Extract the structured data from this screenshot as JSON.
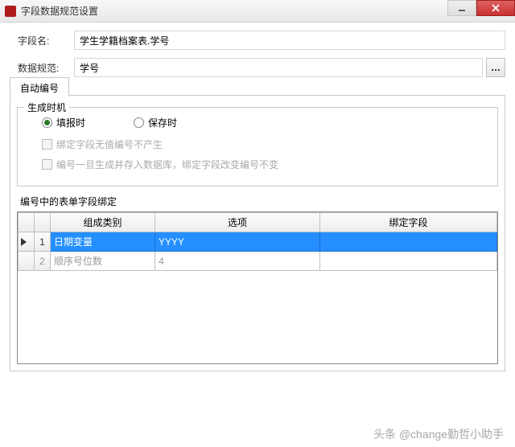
{
  "window": {
    "title": "字段数据规范设置"
  },
  "form": {
    "label_field_name": "字段名:",
    "value_field_name": "学生学籍档案表.学号",
    "label_data_spec": "数据规范:",
    "value_data_spec": "学号",
    "browse_label": "…"
  },
  "tab": {
    "auto_number": "自动编号"
  },
  "timing": {
    "legend": "生成时机",
    "radio_fill": "填报时",
    "radio_save": "保存时",
    "check_nobind": "绑定字段无值编号不产生",
    "check_storefix": "编号一旦生成并存入数据库，绑定字段改变编号不变"
  },
  "binding": {
    "section_label": "编号中的表单字段绑定",
    "col_type": "组成类别",
    "col_option": "选项",
    "col_bind": "绑定字段",
    "rows": [
      {
        "n": "1",
        "type": "日期变量",
        "option": "YYYY",
        "bind": ""
      },
      {
        "n": "2",
        "type": "顺序号位数",
        "option": "4",
        "bind": ""
      }
    ]
  },
  "watermark": "头条 @change勤哲小助手"
}
